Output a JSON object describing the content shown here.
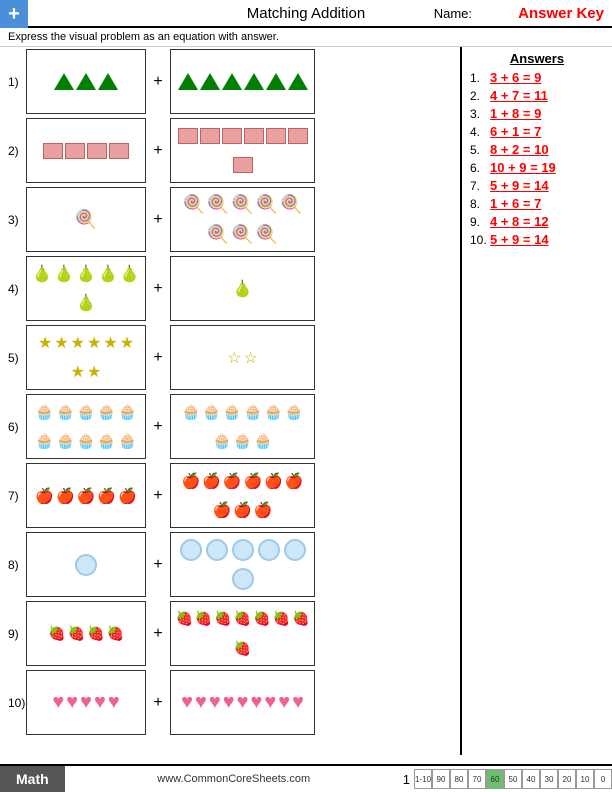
{
  "header": {
    "title": "Matching Addition",
    "name_label": "Name:",
    "answer_key": "Answer Key"
  },
  "instruction": "Express the visual problem as an equation with answer.",
  "answers": {
    "title": "Answers",
    "items": [
      {
        "num": "1.",
        "text": "3 + 6 = 9"
      },
      {
        "num": "2.",
        "text": "4 + 7 = 11"
      },
      {
        "num": "3.",
        "text": "1 + 8 = 9"
      },
      {
        "num": "4.",
        "text": "6 + 1 = 7"
      },
      {
        "num": "5.",
        "text": "8 + 2 = 10"
      },
      {
        "num": "6.",
        "text": "10 + 9 = 19"
      },
      {
        "num": "7.",
        "text": "5 + 9 = 14"
      },
      {
        "num": "8.",
        "text": "1 + 6 = 7"
      },
      {
        "num": "9.",
        "text": "4 + 8 = 12"
      },
      {
        "num": "10.",
        "text": "5 + 9 = 14"
      }
    ]
  },
  "footer": {
    "math_label": "Math",
    "url": "www.CommonCoreSheets.com",
    "page": "1",
    "score_labels": [
      "1-10",
      "90",
      "80",
      "70",
      "60",
      "50",
      "40",
      "30",
      "20",
      "10",
      "0"
    ]
  },
  "problems": [
    {
      "num": "1)",
      "left_count": 3,
      "left_type": "triangle",
      "right_count": 6,
      "right_type": "triangle"
    },
    {
      "num": "2)",
      "left_count": 4,
      "left_type": "rect",
      "right_count": 7,
      "right_type": "rect"
    },
    {
      "num": "3)",
      "left_count": 1,
      "left_type": "swirl",
      "right_count": 8,
      "right_type": "swirl"
    },
    {
      "num": "4)",
      "left_count": 6,
      "left_type": "pear",
      "right_count": 1,
      "right_type": "pear"
    },
    {
      "num": "5)",
      "left_count": 8,
      "left_type": "star",
      "right_count": 2,
      "right_type": "star-outline"
    },
    {
      "num": "6)",
      "left_count": 10,
      "left_type": "muffin",
      "right_count": 9,
      "right_type": "muffin"
    },
    {
      "num": "7)",
      "left_count": 5,
      "left_type": "apple",
      "right_count": 9,
      "right_type": "apple"
    },
    {
      "num": "8)",
      "left_count": 1,
      "left_type": "circle",
      "right_count": 6,
      "right_type": "circle"
    },
    {
      "num": "9)",
      "left_count": 4,
      "left_type": "strawberry",
      "right_count": 8,
      "right_type": "strawberry"
    },
    {
      "num": "10)",
      "left_count": 5,
      "left_type": "heart",
      "right_count": 9,
      "right_type": "heart"
    }
  ]
}
